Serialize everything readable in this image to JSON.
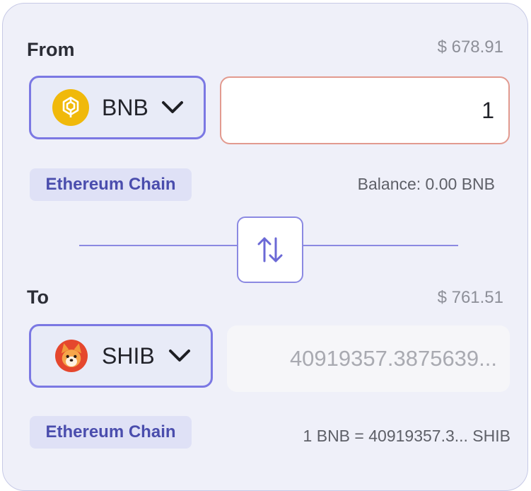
{
  "from": {
    "label": "From",
    "usd_value": "$ 678.91",
    "token": {
      "symbol": "BNB",
      "icon": "bnb-logo-icon",
      "color": "#f0b90b"
    },
    "amount": "1",
    "chain": "Ethereum Chain",
    "balance_text": "Balance: 0.00 BNB"
  },
  "swap": {
    "icon": "swap-arrows-icon"
  },
  "to": {
    "label": "To",
    "usd_value": "$ 761.51",
    "token": {
      "symbol": "SHIB",
      "icon": "shib-logo-icon",
      "color": "#e5472d"
    },
    "amount": "40919357.3875639...",
    "chain": "Ethereum Chain",
    "rate_text": "1 BNB = 40919357.3... SHIB"
  },
  "colors": {
    "accent": "#7b78e3",
    "card_background": "#eff0f9",
    "badge_text": "#4a4dad",
    "input_border": "#e29a8f"
  }
}
